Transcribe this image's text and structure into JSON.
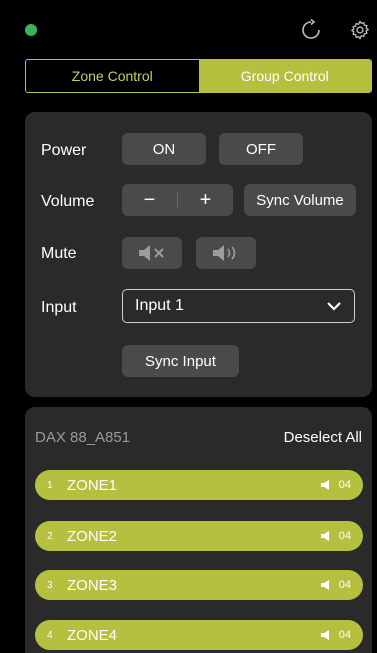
{
  "colors": {
    "accent": "#b6c03f",
    "status": "#3bb35a",
    "panel": "#2a2a2a",
    "button": "#4a4a4a"
  },
  "tabs": {
    "zone_label": "Zone Control",
    "group_label": "Group Control"
  },
  "controls": {
    "power_label": "Power",
    "power_on": "ON",
    "power_off": "OFF",
    "volume_label": "Volume",
    "volume_minus": "−",
    "volume_plus": "+",
    "sync_volume": "Sync Volume",
    "mute_label": "Mute",
    "input_label": "Input",
    "input_value": "Input 1",
    "sync_input": "Sync Input"
  },
  "zones_panel": {
    "title": "DAX 88_A851",
    "deselect_all": "Deselect All",
    "zones": [
      {
        "num": "1",
        "name": "ZONE1",
        "vol": "04"
      },
      {
        "num": "2",
        "name": "ZONE2",
        "vol": "04"
      },
      {
        "num": "3",
        "name": "ZONE3",
        "vol": "04"
      },
      {
        "num": "4",
        "name": "ZONE4",
        "vol": "04"
      }
    ]
  }
}
